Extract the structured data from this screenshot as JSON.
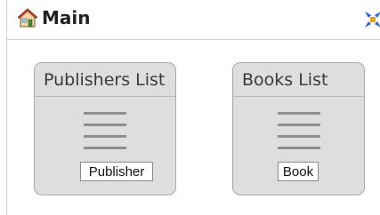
{
  "header": {
    "title": "Main",
    "home_icon": "home-icon",
    "collapse_icon": "collapse-arrows-icon"
  },
  "tiles": [
    {
      "title": "Publishers List",
      "icon": "list-icon",
      "button_label": "Publisher"
    },
    {
      "title": "Books List",
      "icon": "list-icon",
      "button_label": "Book"
    }
  ],
  "colors": {
    "tile_background": "#dedede",
    "tile_border": "#a9a9a9",
    "list_icon": "#8f8f8f",
    "collapse_icon": "#2f5fd0",
    "collapse_icon_accent": "#e0a21a"
  }
}
